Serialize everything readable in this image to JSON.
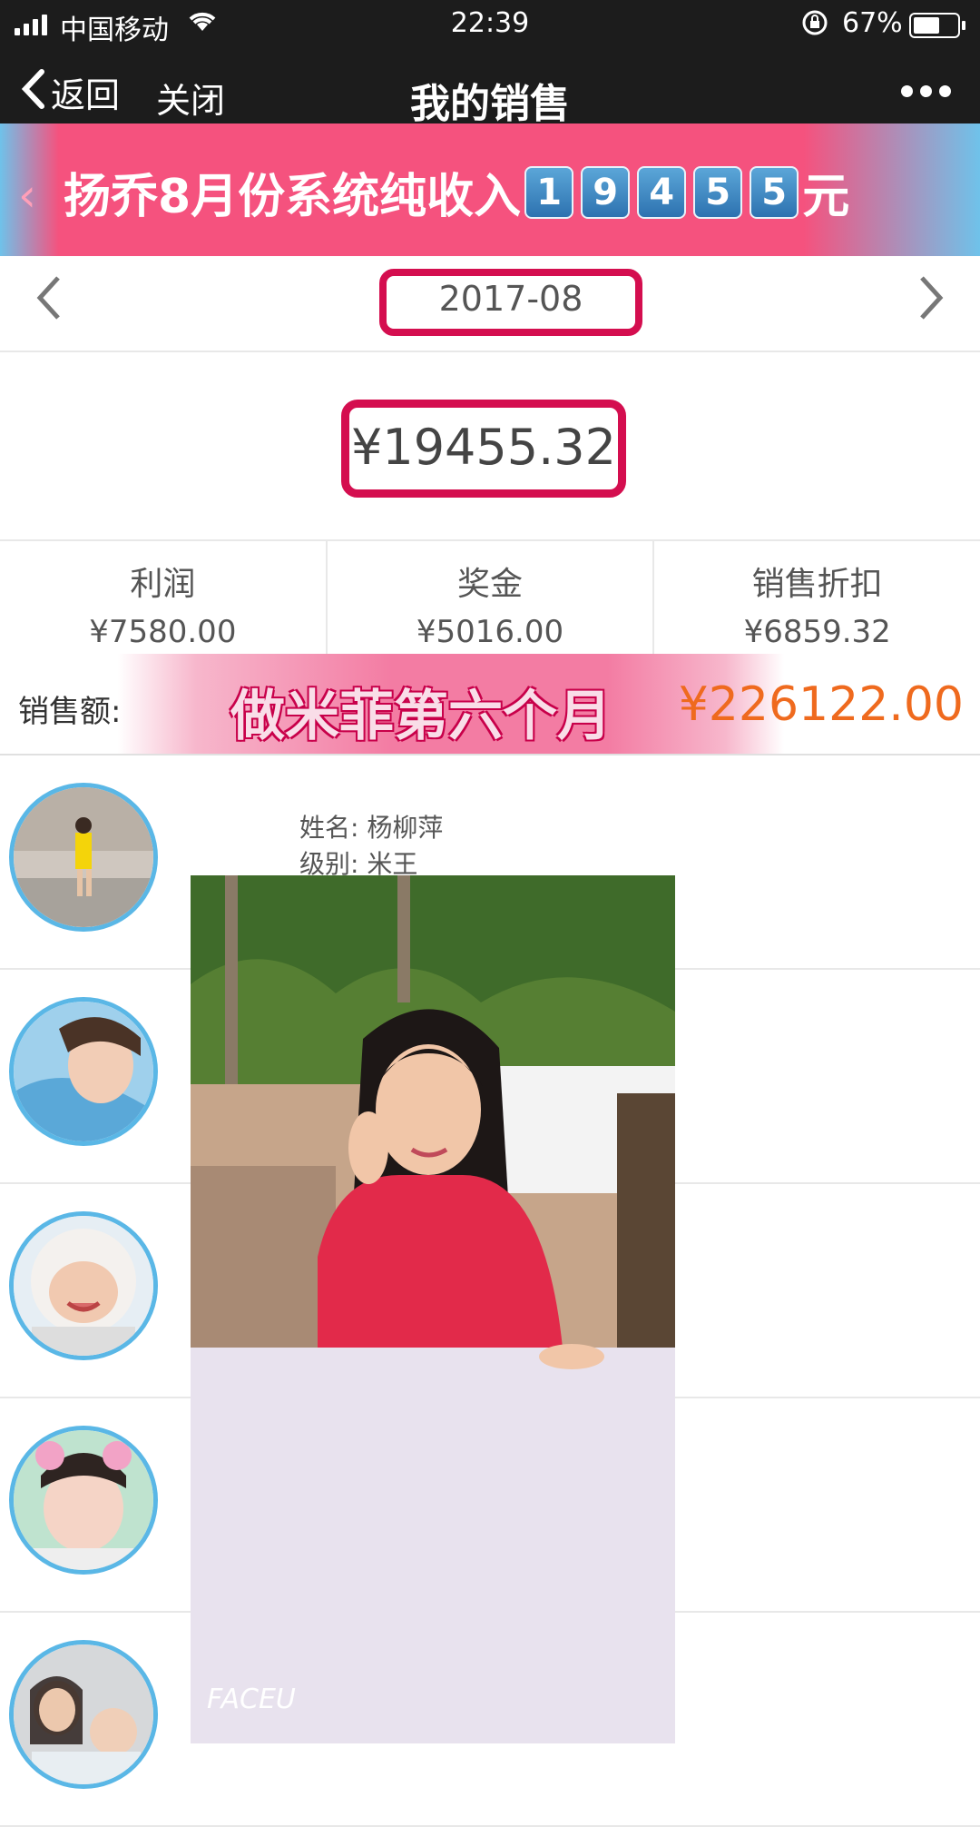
{
  "status_bar": {
    "carrier": "中国移动",
    "time": "22:39",
    "battery": "67%",
    "battery_level": 0.67
  },
  "nav": {
    "back_label": "返回",
    "close_label": "关闭",
    "title": "我的销售"
  },
  "banner": {
    "prefix": "扬乔8月份系统纯收入",
    "digits": [
      "1",
      "9",
      "4",
      "5",
      "5"
    ],
    "suffix": "元"
  },
  "month": {
    "value": "2017-08"
  },
  "total": {
    "value": "¥19455.32"
  },
  "stats": [
    {
      "label": "利润",
      "value": "¥7580.00"
    },
    {
      "label": "奖金",
      "value": "¥5016.00"
    },
    {
      "label": "销售折扣",
      "value": "¥6859.32"
    }
  ],
  "sales": {
    "label": "销售额:",
    "overlay": "做米菲第六个月",
    "amount": "¥226122.00"
  },
  "member": {
    "name_label": "姓名:",
    "name": "杨柳萍",
    "level_label": "级别:",
    "level": "米王"
  },
  "photo": {
    "watermark": "FACEU"
  },
  "colors": {
    "accent": "#d40e4f",
    "banner": "#f5527e",
    "amount": "#ef6a1e",
    "avatar_ring": "#5ab7e6",
    "nav_bg": "#1c1c1c"
  }
}
